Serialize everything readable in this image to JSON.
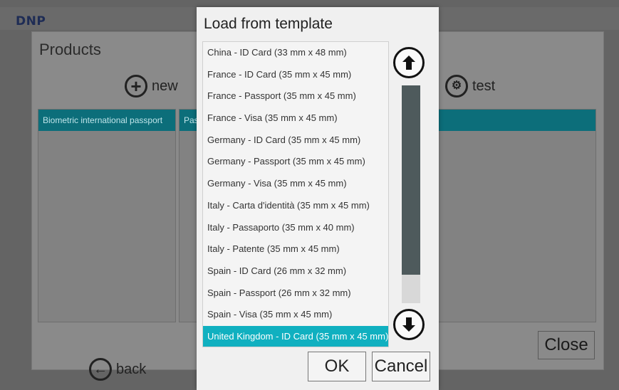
{
  "app": {
    "brand": "DNP",
    "products_title": "Products",
    "new_label": "new",
    "test_label": "test",
    "back_label": "back",
    "close_label": "Close",
    "columns": [
      "Biometric international passport",
      "Pas"
    ]
  },
  "dialog": {
    "title": "Load from template",
    "items": [
      "China - ID Card (33 mm x 48 mm)",
      "France - ID Card (35 mm x 45 mm)",
      "France - Passport (35 mm x 45 mm)",
      "France - Visa (35 mm x 45 mm)",
      "Germany - ID Card (35 mm x 45 mm)",
      "Germany - Passport (35 mm x 45 mm)",
      "Germany - Visa (35 mm x 45 mm)",
      "Italy - Carta d'identità (35 mm x 45 mm)",
      "Italy - Passaporto (35 mm x 40 mm)",
      "Italy - Patente (35 mm x 45 mm)",
      "Spain - ID Card (26 mm x 32 mm)",
      "Spain - Passport (26 mm x 32 mm)",
      "Spain - Visa (35 mm x 45 mm)",
      "United Kingdom - ID Card (35 mm x 45 mm)"
    ],
    "selected_index": 13,
    "ok_label": "OK",
    "cancel_label": "Cancel"
  },
  "colors": {
    "accent": "#10b0c0",
    "header_teal": "#0c6e7a",
    "brand": "#1e2c55"
  },
  "icons": {
    "new": "plus-circle-icon",
    "test": "gear-circle-icon",
    "back": "arrow-left-circle-icon",
    "scroll_up": "arrow-up-circle-icon",
    "scroll_down": "arrow-down-circle-icon"
  }
}
